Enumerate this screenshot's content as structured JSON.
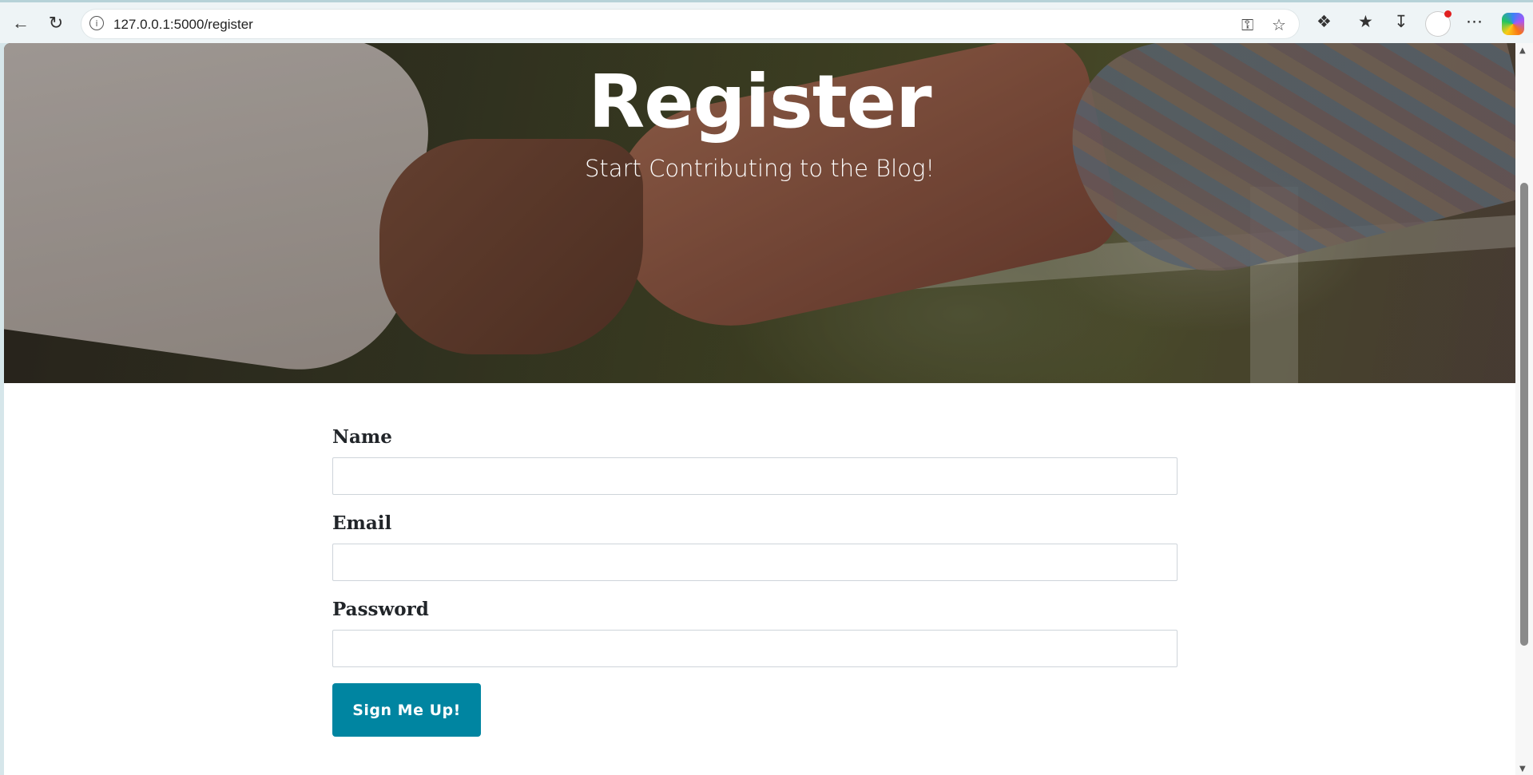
{
  "browser": {
    "url": "127.0.0.1:5000/register",
    "icons": {
      "back": "arrow-left-icon",
      "refresh": "refresh-icon",
      "site_info": "info-icon",
      "password": "key-icon",
      "favorite": "star-icon",
      "extensions": "puzzle-icon",
      "favorites": "favorites-list-icon",
      "downloads": "download-icon",
      "more": "ellipsis-icon",
      "copilot": "copilot-icon"
    }
  },
  "masthead": {
    "title": "Register",
    "subtitle": "Start Contributing to the Blog!"
  },
  "form": {
    "name_label": "Name",
    "email_label": "Email",
    "password_label": "Password",
    "name_value": "",
    "email_value": "",
    "password_value": "",
    "submit_label": "Sign Me Up!"
  },
  "colors": {
    "button": "#0085a1",
    "heading_text": "#212529",
    "input_border": "#ced4da"
  }
}
